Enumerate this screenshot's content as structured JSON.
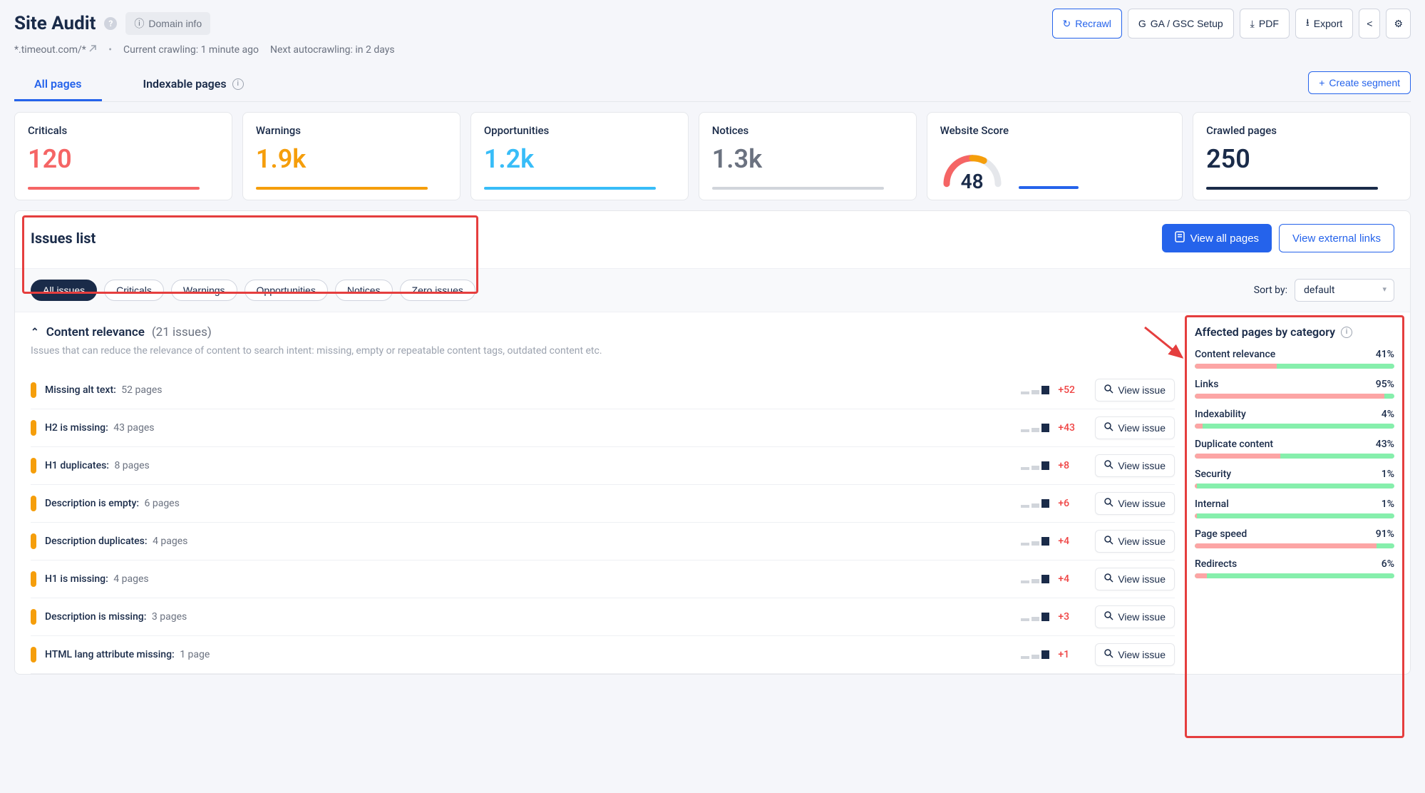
{
  "header": {
    "title": "Site Audit",
    "domain_info": "Domain info",
    "domain": "*.timeout.com/*",
    "crawl_status": "Current crawling: 1 minute ago",
    "next_crawl": "Next autocrawling: in 2 days",
    "buttons": {
      "recrawl": "Recrawl",
      "gsc": "GA / GSC Setup",
      "pdf": "PDF",
      "export": "Export"
    }
  },
  "tabs": {
    "all_pages": "All pages",
    "indexable": "Indexable pages",
    "create_segment": "Create segment"
  },
  "cards": {
    "criticals": {
      "label": "Criticals",
      "value": "120"
    },
    "warnings": {
      "label": "Warnings",
      "value": "1.9k"
    },
    "opportunities": {
      "label": "Opportunities",
      "value": "1.2k"
    },
    "notices": {
      "label": "Notices",
      "value": "1.3k"
    },
    "score": {
      "label": "Website Score",
      "value": "48"
    },
    "crawled": {
      "label": "Crawled pages",
      "value": "250"
    }
  },
  "issues": {
    "title": "Issues list",
    "view_all": "View all pages",
    "view_external": "View external links",
    "filters": {
      "all": "All issues",
      "criticals": "Criticals",
      "warnings": "Warnings",
      "opportunities": "Opportunities",
      "notices": "Notices",
      "zero": "Zero issues"
    },
    "sort_label": "Sort by:",
    "sort_value": "default",
    "group_title": "Content relevance",
    "group_count": "(21 issues)",
    "group_desc": "Issues that can reduce the relevance of content to search intent: missing, empty or repeatable content tags, outdated content etc.",
    "view_issue_label": "View issue",
    "rows": [
      {
        "name": "Missing alt text:",
        "pages": "52 pages",
        "delta": "+52"
      },
      {
        "name": "H2 is missing:",
        "pages": "43 pages",
        "delta": "+43"
      },
      {
        "name": "H1 duplicates:",
        "pages": "8 pages",
        "delta": "+8"
      },
      {
        "name": "Description is empty:",
        "pages": "6 pages",
        "delta": "+6"
      },
      {
        "name": "Description duplicates:",
        "pages": "4 pages",
        "delta": "+4"
      },
      {
        "name": "H1 is missing:",
        "pages": "4 pages",
        "delta": "+4"
      },
      {
        "name": "Description is missing:",
        "pages": "3 pages",
        "delta": "+3"
      },
      {
        "name": "HTML lang attribute missing:",
        "pages": "1 page",
        "delta": "+1"
      }
    ]
  },
  "categories": {
    "title": "Affected pages by category",
    "items": [
      {
        "name": "Content relevance",
        "pct": "41%",
        "fill": 41
      },
      {
        "name": "Links",
        "pct": "95%",
        "fill": 95
      },
      {
        "name": "Indexability",
        "pct": "4%",
        "fill": 4
      },
      {
        "name": "Duplicate content",
        "pct": "43%",
        "fill": 43
      },
      {
        "name": "Security",
        "pct": "1%",
        "fill": 1
      },
      {
        "name": "Internal",
        "pct": "1%",
        "fill": 1
      },
      {
        "name": "Page speed",
        "pct": "91%",
        "fill": 91
      },
      {
        "name": "Redirects",
        "pct": "6%",
        "fill": 6
      }
    ]
  }
}
